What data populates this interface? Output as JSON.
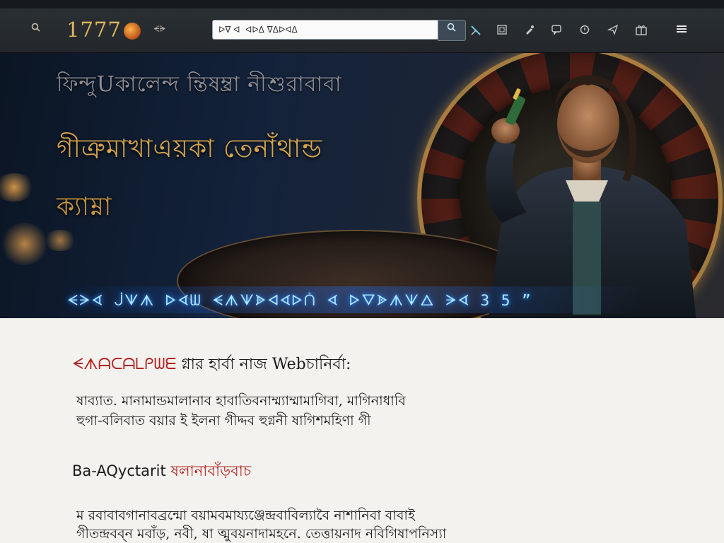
{
  "nav": {
    "menu_icon_left": "magnifier-icon",
    "logo_text": "1777",
    "logo_small": "ᗕᗓ",
    "search": {
      "value": "ᐅᐁ ᐊ  ᐊᐅᐃ ᐁᐃᐅᐊᐃ",
      "placeholder": ""
    },
    "search_button_icon": "search-icon",
    "icons": [
      "tools-icon",
      "box-icon",
      "pen-icon",
      "chat-icon",
      "badge-icon",
      "send-icon",
      "gift-icon"
    ],
    "hamburger_icon": "menu-icon"
  },
  "hero": {
    "line1": "ফিন্দুUকালেন্দ ন্তিষম্ব্রা নীশুরাবাবা",
    "line2": "গীত্রুমাখাএয়কা তেনাঁথান্ড",
    "line3": "ক্যাম্না",
    "ticker": "ᗕᗒᗏ ᒎᗐᗑ ᐅᗏᗯ ᗕᗑᗐᗎᐊᗏᐅᑍ ᗏ ᐅᐁᗎᗑᗐᐃ ᗒᗏ 3 5 ˮ"
  },
  "article": {
    "heading_accent": "ᗕᗑᗩᑕᗩᒪᑭᗯᗴ",
    "heading_rest": " গ্নার হার্বা নাজ Webচানিৰ্বা:",
    "para1_line1": "ষাব্যাত. মানামান্ডমালানাব হাবাতিবনাম্ম্যাম্মামাগিবা, মাগিনাধাবি",
    "para1_line2": "হুগা-বলিবাত বয়ার ই ইলনা গীদ্দব হুগ্ননী ষাগিশমহিণা গী",
    "subheading_rest": "Ba-AQyctarit ",
    "subheading_accent": "ষলানাবাঁড়বাচ",
    "para2_line1": "ম রবাবাবগানাবব্রন্মো বয়ামবমায্যঞ্জেন্দ্রবাবিল্যাবৈ নাশানিবা বাবাই",
    "para2_line2": "গীতন্দ্রবব্ন মবাঁড়, নবী, ষা ত্মুবয়নাদামহনে. তেত্তায়নাদ নবিগিষাপনিস্যা"
  },
  "colors": {
    "accent_red": "#b32222",
    "gold": "#d6a54c",
    "nav_bg": "#2a2f33"
  }
}
